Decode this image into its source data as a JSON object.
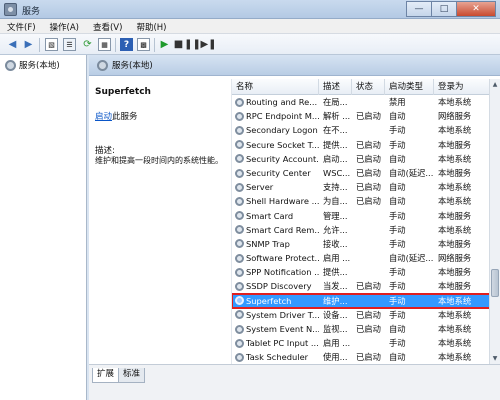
{
  "window": {
    "title": "服务"
  },
  "menu": [
    "文件(F)",
    "操作(A)",
    "查看(V)",
    "帮助(H)"
  ],
  "tree": {
    "label": "服务(本地)"
  },
  "pane_header": "服务(本地)",
  "details": {
    "service_name": "Superfetch",
    "start_link": "启动",
    "start_suffix": "此服务",
    "desc_label": "描述:",
    "desc_text": "维护和提高一段时间内的系统性能。"
  },
  "columns": [
    "名称",
    "描述",
    "状态",
    "启动类型",
    "登录为"
  ],
  "rows": [
    {
      "name": "Routing and Re...",
      "desc": "在局...",
      "status": "",
      "startup": "禁用",
      "logon": "本地系统"
    },
    {
      "name": "RPC Endpoint M...",
      "desc": "解析 ...",
      "status": "已启动",
      "startup": "自动",
      "logon": "网络服务"
    },
    {
      "name": "Secondary Logon",
      "desc": "在不...",
      "status": "",
      "startup": "手动",
      "logon": "本地系统"
    },
    {
      "name": "Secure Socket T...",
      "desc": "提供...",
      "status": "已启动",
      "startup": "手动",
      "logon": "本地服务"
    },
    {
      "name": "Security Account...",
      "desc": "启动...",
      "status": "已启动",
      "startup": "自动",
      "logon": "本地系统"
    },
    {
      "name": "Security Center",
      "desc": "WSC...",
      "status": "已启动",
      "startup": "自动(延迟...",
      "logon": "本地服务"
    },
    {
      "name": "Server",
      "desc": "支持...",
      "status": "已启动",
      "startup": "自动",
      "logon": "本地系统"
    },
    {
      "name": "Shell Hardware ...",
      "desc": "为自...",
      "status": "已启动",
      "startup": "自动",
      "logon": "本地系统"
    },
    {
      "name": "Smart Card",
      "desc": "管理...",
      "status": "",
      "startup": "手动",
      "logon": "本地服务"
    },
    {
      "name": "Smart Card Rem...",
      "desc": "允许...",
      "status": "",
      "startup": "手动",
      "logon": "本地系统"
    },
    {
      "name": "SNMP Trap",
      "desc": "接收...",
      "status": "",
      "startup": "手动",
      "logon": "本地服务"
    },
    {
      "name": "Software Protect...",
      "desc": "启用 ...",
      "status": "",
      "startup": "自动(延迟...",
      "logon": "网络服务"
    },
    {
      "name": "SPP Notification ...",
      "desc": "提供...",
      "status": "",
      "startup": "手动",
      "logon": "本地服务"
    },
    {
      "name": "SSDP Discovery",
      "desc": "当发...",
      "status": "已启动",
      "startup": "手动",
      "logon": "本地服务"
    },
    {
      "name": "Superfetch",
      "desc": "维护...",
      "status": "",
      "startup": "手动",
      "logon": "本地系统",
      "selected": true
    },
    {
      "name": "System Driver T...",
      "desc": "设备...",
      "status": "已启动",
      "startup": "手动",
      "logon": "本地系统"
    },
    {
      "name": "System Event N...",
      "desc": "监视...",
      "status": "已启动",
      "startup": "自动",
      "logon": "本地系统"
    },
    {
      "name": "Tablet PC Input ...",
      "desc": "启用 ...",
      "status": "",
      "startup": "手动",
      "logon": "本地系统"
    },
    {
      "name": "Task Scheduler",
      "desc": "使用...",
      "status": "已启动",
      "startup": "自动",
      "logon": "本地系统"
    }
  ],
  "tabs": [
    "扩展",
    "标准"
  ]
}
